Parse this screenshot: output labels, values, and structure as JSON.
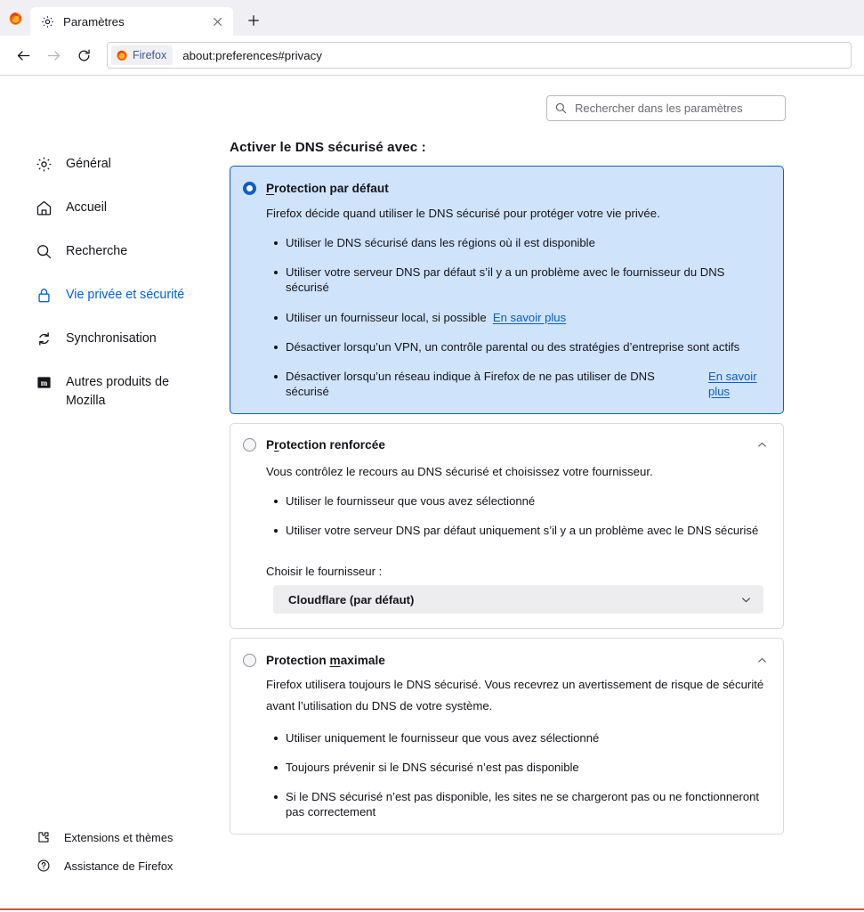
{
  "browser": {
    "tab": {
      "title": "Paramètres",
      "icon": "gear-icon",
      "close_icon": "close-icon"
    },
    "new_tab_label": "+",
    "back_icon": "arrow-left-icon",
    "forward_icon": "arrow-right-icon",
    "reload_icon": "reload-icon",
    "url_chip_label": "Firefox",
    "url": "about:preferences#privacy"
  },
  "search": {
    "placeholder": "Rechercher dans les paramètres",
    "value": "",
    "icon": "search-icon"
  },
  "sidebar": {
    "items": [
      {
        "label": "Général",
        "icon": "gear-icon",
        "selected": false
      },
      {
        "label": "Accueil",
        "icon": "home-icon",
        "selected": false
      },
      {
        "label": "Recherche",
        "icon": "search-icon",
        "selected": false
      },
      {
        "label": "Vie privée et sécurité",
        "icon": "lock-icon",
        "selected": true
      },
      {
        "label": "Synchronisation",
        "icon": "sync-icon",
        "selected": false
      },
      {
        "label": "Autres produits de Mozilla",
        "icon": "mozilla-m-icon",
        "selected": false
      }
    ],
    "footer": [
      {
        "label": "Extensions et thèmes",
        "icon": "extension-icon"
      },
      {
        "label": "Assistance de Firefox",
        "icon": "question-circle-icon"
      }
    ]
  },
  "main": {
    "section_title": "Activer le DNS sécurisé avec :",
    "cards": [
      {
        "id": "default",
        "title_pre": "",
        "title_key": "P",
        "title_post": "rotection par défaut",
        "selected": true,
        "collapsible": false,
        "description": "Firefox décide quand utiliser le DNS sécurisé pour protéger votre vie privée.",
        "bullets": [
          {
            "text": "Utiliser le DNS sécurisé dans les régions où il est disponible"
          },
          {
            "text": "Utiliser votre serveur DNS par défaut s’il y a un problème avec le fournisseur du DNS sécurisé"
          },
          {
            "text": "Utiliser un fournisseur local, si possible",
            "link": "En savoir plus",
            "link_inline": true
          },
          {
            "text": "Désactiver lorsqu’un VPN, un contrôle parental ou des stratégies d’entreprise sont actifs"
          },
          {
            "text": "Désactiver lorsqu’un réseau indique à Firefox de ne pas utiliser de DNS sécurisé",
            "link": "En savoir plus",
            "link_side": true
          }
        ]
      },
      {
        "id": "increased",
        "title_pre": "P",
        "title_key": "r",
        "title_post": "otection renforcée",
        "selected": false,
        "collapsible": true,
        "collapse_icon": "chevron-up-icon",
        "description": "Vous contrôlez le recours au DNS sécurisé et choisissez votre fournisseur.",
        "bullets": [
          {
            "text": "Utiliser le fournisseur que vous avez sélectionné"
          },
          {
            "text": "Utiliser votre serveur DNS par défaut uniquement s’il y a un problème avec le DNS sécurisé"
          }
        ],
        "provider_label": "Choisir le fournisseur :",
        "provider_value": "Cloudflare (par défaut)",
        "provider_chevron": "chevron-down-icon"
      },
      {
        "id": "max",
        "title_pre": "Protection ",
        "title_key": "m",
        "title_post": "aximale",
        "selected": false,
        "collapsible": true,
        "collapse_icon": "chevron-up-icon",
        "description": "Firefox utilisera toujours le DNS sécurisé. Vous recevrez un avertissement de risque de sécurité avant l’utilisation du DNS de votre système.",
        "bullets": [
          {
            "text": "Utiliser uniquement le fournisseur que vous avez sélectionné"
          },
          {
            "text": "Toujours prévenir si le DNS sécurisé n’est pas disponible"
          },
          {
            "text": "Si le DNS sécurisé n’est pas disponible, les sites ne se chargeront pas ou ne fonctionneront pas correctement"
          }
        ]
      }
    ]
  },
  "colors": {
    "accent": "#0060df",
    "selected_card_bg": "#cfe3fb",
    "selected_card_border": "#0a5ec7",
    "link": "#0a5ec7",
    "text": "#15141a",
    "chrome_bg": "#f0f0f4"
  }
}
